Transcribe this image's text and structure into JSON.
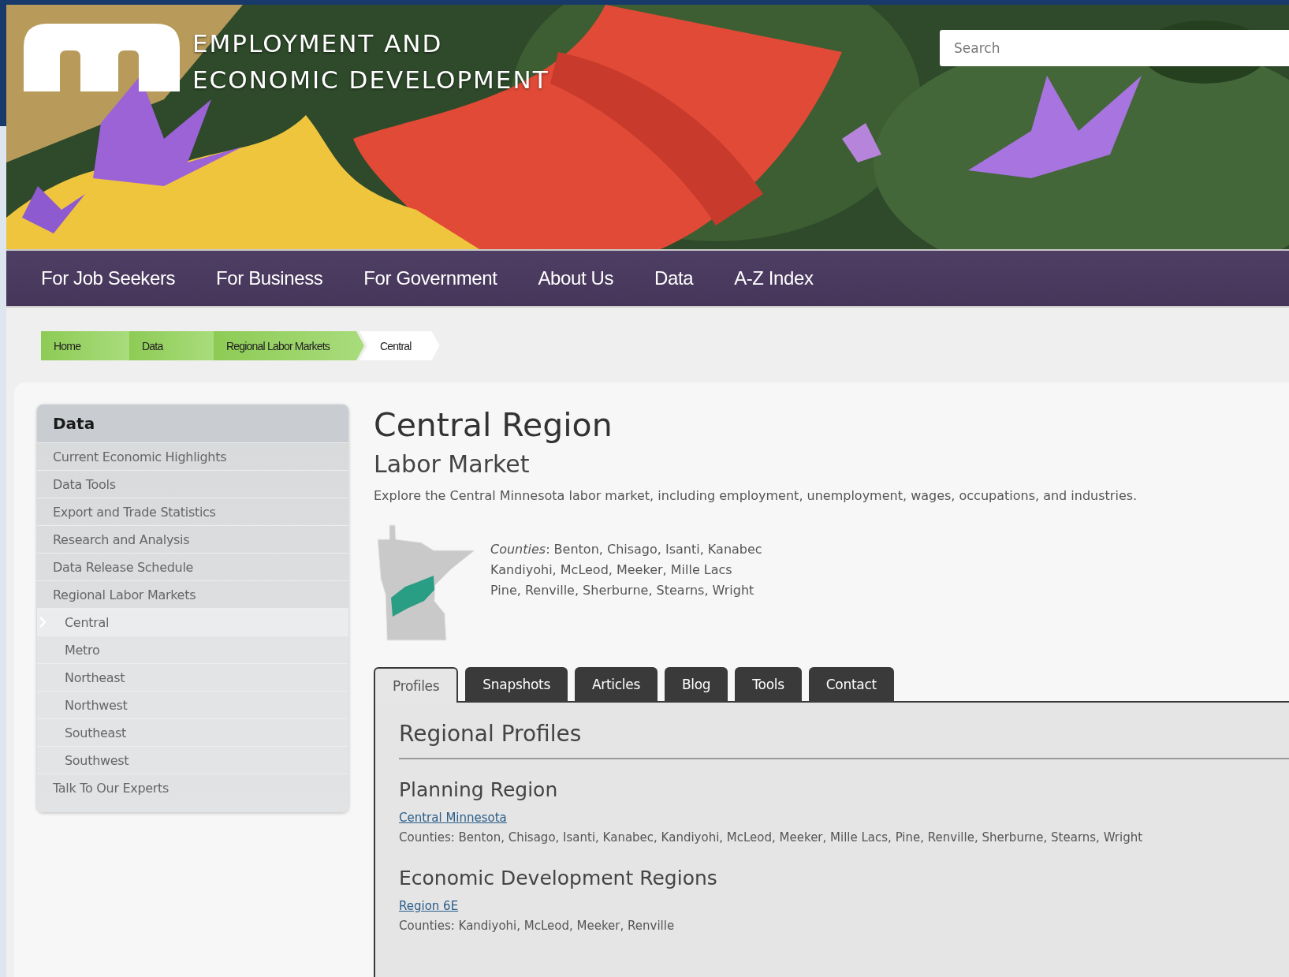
{
  "header": {
    "site_title_lines": [
      "EMPLOYMENT AND",
      "ECONOMIC DEVELOPMENT"
    ],
    "search": {
      "placeholder": "Search"
    }
  },
  "nav": [
    {
      "label": "For Job Seekers"
    },
    {
      "label": "For Business"
    },
    {
      "label": "For Government"
    },
    {
      "label": "About Us"
    },
    {
      "label": "Data"
    },
    {
      "label": "A-Z Index"
    }
  ],
  "breadcrumb": [
    {
      "label": "Home",
      "current": false
    },
    {
      "label": "Data",
      "current": false
    },
    {
      "label": "Regional Labor Markets",
      "current": false
    },
    {
      "label": "Central",
      "current": true
    }
  ],
  "sidebar": {
    "heading": "Data",
    "items": [
      {
        "label": "Current Economic Highlights",
        "selected": false
      },
      {
        "label": "Data Tools",
        "selected": false
      },
      {
        "label": "Export and Trade Statistics",
        "selected": false
      },
      {
        "label": "Research and Analysis",
        "selected": false
      },
      {
        "label": "Data Release Schedule",
        "selected": false
      },
      {
        "label": "Regional Labor Markets",
        "selected": false,
        "children": [
          {
            "label": "Central",
            "selected": true
          },
          {
            "label": "Metro",
            "selected": false
          },
          {
            "label": "Northeast",
            "selected": false
          },
          {
            "label": "Northwest",
            "selected": false
          },
          {
            "label": "Southeast",
            "selected": false
          },
          {
            "label": "Southwest",
            "selected": false
          }
        ]
      },
      {
        "label": "Talk To Our Experts",
        "selected": false
      }
    ]
  },
  "page": {
    "title": "Central Region",
    "subtitle": "Labor Market",
    "description": "Explore the Central Minnesota labor market, including employment, unemployment, wages, occupations, and industries.",
    "counties_lines": [
      "*Counties*: Benton, Chisago, Isanti, Kanabec",
      "Kandiyohi, McLeod, Meeker, Mille Lacs",
      "Pine, Renville, Sherburne, Stearns, Wright"
    ]
  },
  "tabs": [
    {
      "label": "Profiles",
      "selected": true
    },
    {
      "label": "Snapshots",
      "selected": false
    },
    {
      "label": "Articles",
      "selected": false
    },
    {
      "label": "Blog",
      "selected": false
    },
    {
      "label": "Tools",
      "selected": false
    },
    {
      "label": "Contact",
      "selected": false
    }
  ],
  "panel": {
    "heading": "Regional Profiles",
    "sections": [
      {
        "heading": "Planning Region",
        "link": "Central Minnesota",
        "counties": "Counties: Benton, Chisago, Isanti, Kanabec, Kandiyohi, McLeod, Meeker, Mille Lacs, Pine, Renville, Sherburne, Stearns, Wright"
      },
      {
        "heading": "Economic Development Regions",
        "link": "Region 6E",
        "counties": "Counties: Kandiyohi, McLeod, Meeker, Renville"
      }
    ]
  }
}
